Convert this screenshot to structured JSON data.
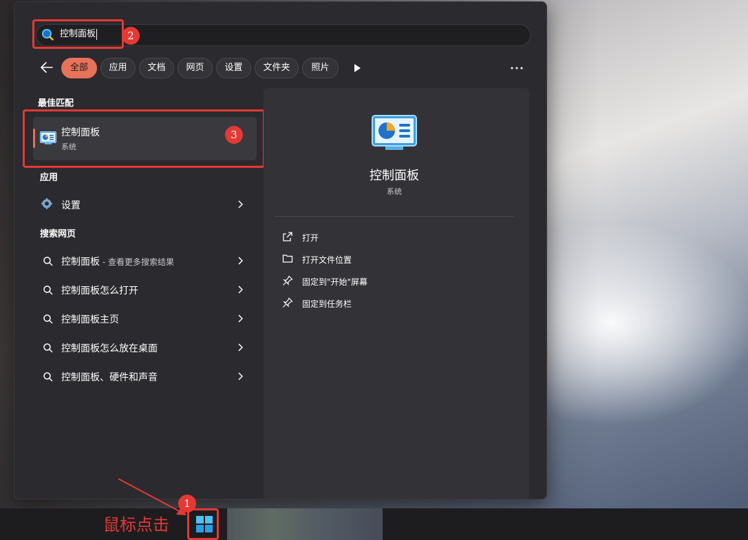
{
  "search": {
    "query": "控制面板"
  },
  "filters": {
    "chips": [
      {
        "label": "全部",
        "active": true
      },
      {
        "label": "应用",
        "active": false
      },
      {
        "label": "文档",
        "active": false
      },
      {
        "label": "网页",
        "active": false
      },
      {
        "label": "设置",
        "active": false
      },
      {
        "label": "文件夹",
        "active": false
      },
      {
        "label": "照片",
        "active": false
      }
    ],
    "back_icon": "back-arrow-icon",
    "play_icon": "play-icon",
    "more_icon": "more-icon"
  },
  "best_match": {
    "heading": "最佳匹配",
    "title": "控制面板",
    "subtitle": "系统",
    "icon": "control-panel-icon"
  },
  "apps": {
    "heading": "应用",
    "items": [
      {
        "label": "设置",
        "icon": "gear-icon"
      }
    ]
  },
  "web": {
    "heading": "搜索网页",
    "items": [
      {
        "label": "控制面板",
        "suffix": " - 查看更多搜索结果"
      },
      {
        "label": "控制面板怎么打开",
        "suffix": ""
      },
      {
        "label": "控制面板主页",
        "suffix": ""
      },
      {
        "label": "控制面板怎么放在桌面",
        "suffix": ""
      },
      {
        "label": "控制面板、硬件和声音",
        "suffix": ""
      }
    ]
  },
  "preview": {
    "title": "控制面板",
    "subtitle": "系统",
    "actions": [
      {
        "label": "打开",
        "icon": "open-external-icon"
      },
      {
        "label": "打开文件位置",
        "icon": "folder-icon"
      },
      {
        "label": "固定到\"开始\"屏幕",
        "icon": "pin-icon"
      },
      {
        "label": "固定到任务栏",
        "icon": "pin-icon"
      }
    ]
  },
  "annotations": {
    "step1": "1",
    "step2": "2",
    "step3": "3",
    "click_hint": "鼠标点击",
    "color": "#e53935"
  },
  "colors": {
    "accent": "#e8725a",
    "panel": "#2b2a2e"
  }
}
